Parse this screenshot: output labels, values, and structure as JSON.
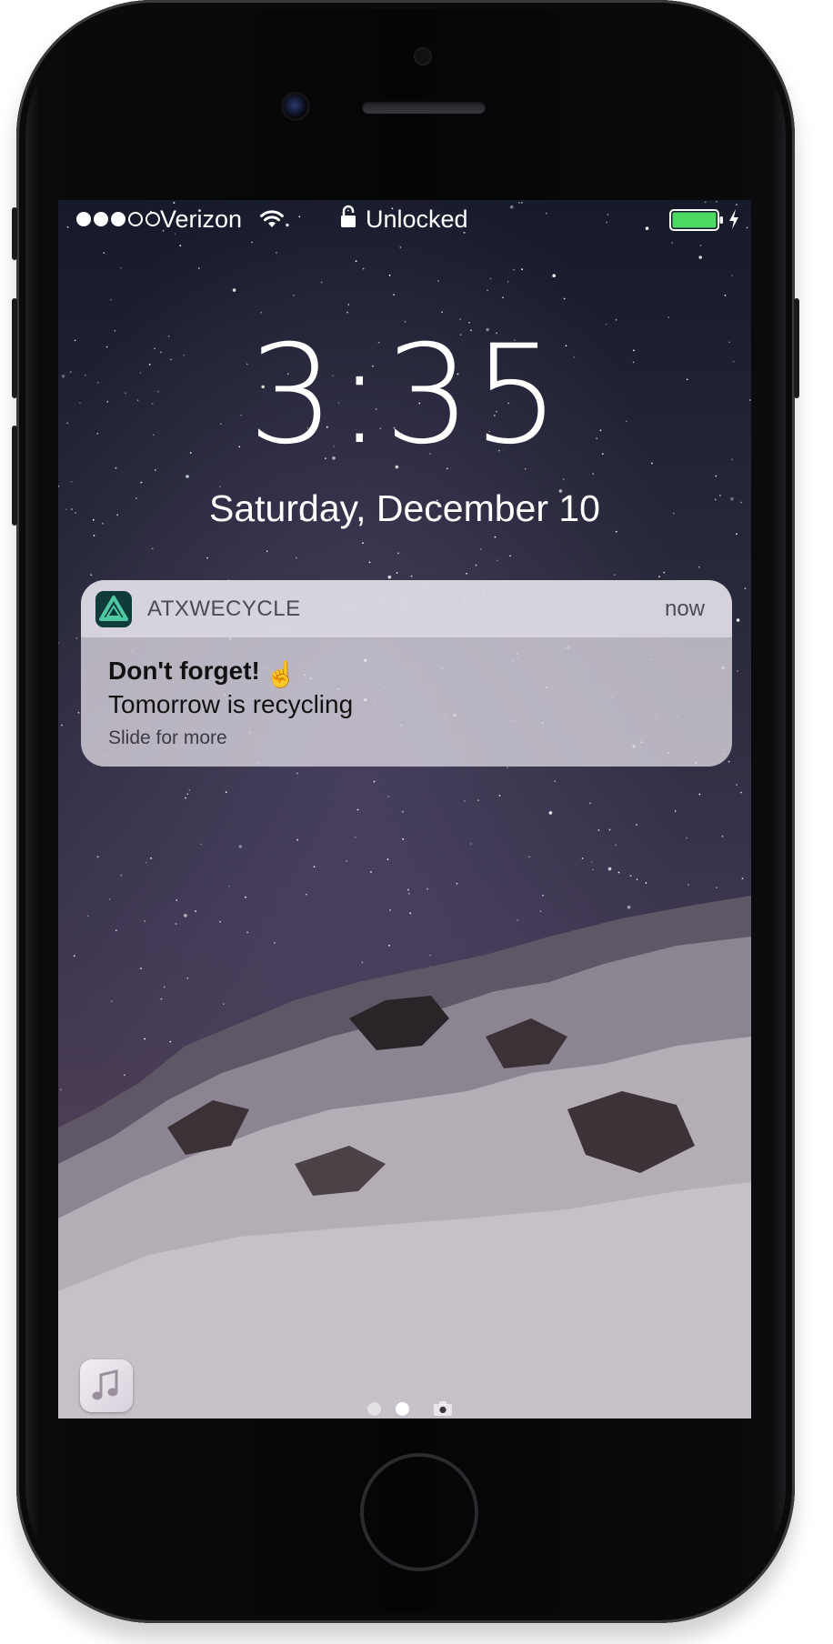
{
  "status_bar": {
    "signal_bars": 3,
    "signal_total": 5,
    "carrier": "Verizon",
    "lock_status": "Unlocked",
    "battery_level": 1.0,
    "battery_color": "#4cd964",
    "icons": [
      "wifi-icon",
      "lock-icon",
      "battery-icon",
      "charging-bolt-icon"
    ]
  },
  "lock_screen": {
    "time": "3:35",
    "date": "Saturday, December 10"
  },
  "notification": {
    "app_name": "ATXWECYCLE",
    "app_icon": "recycle-triangle-icon",
    "app_icon_color": "#4ec9a4",
    "time": "now",
    "title": "Don't forget!",
    "title_emoji": "☝️",
    "body": "Tomorrow is recycling",
    "hint": "Slide for more"
  },
  "bottom": {
    "music_icon": "music-note-icon",
    "page_count": 2,
    "active_page": 2,
    "camera_icon": "camera-icon"
  }
}
